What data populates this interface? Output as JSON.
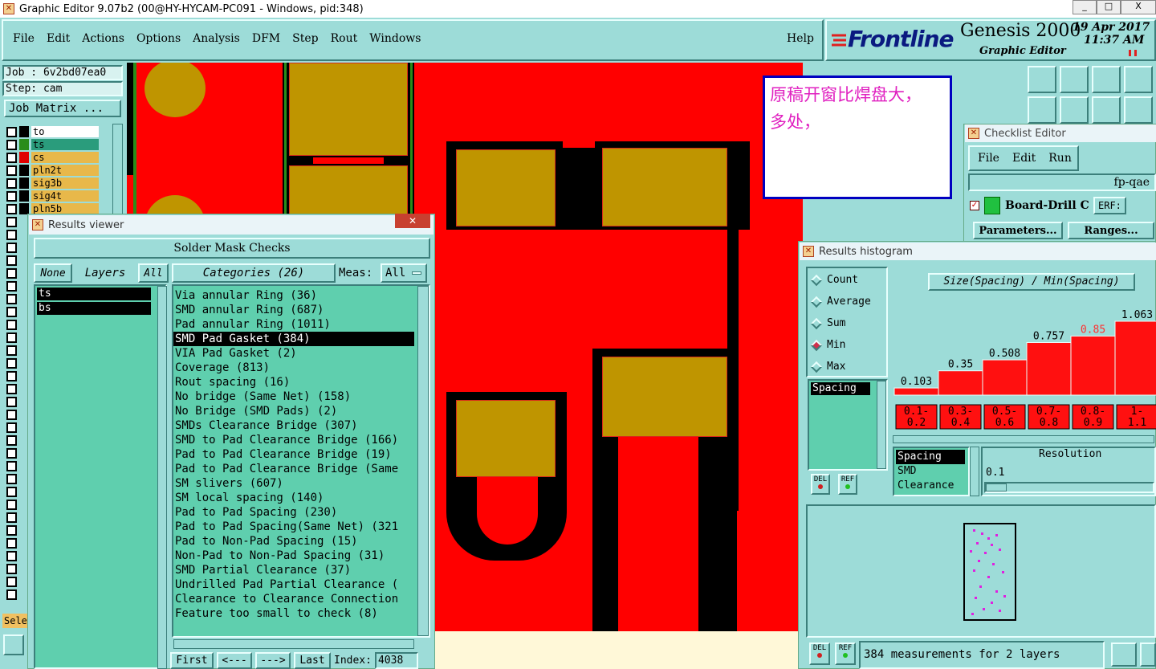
{
  "window": {
    "title": "Graphic Editor 9.07b2 (00@HY-HYCAM-PC091 - Windows, pid:348)",
    "min": "_",
    "max": "□",
    "close": "X"
  },
  "menu": [
    "File",
    "Edit",
    "Actions",
    "Options",
    "Analysis",
    "DFM",
    "Step",
    "Rout",
    "Windows"
  ],
  "help": "Help",
  "brand": {
    "logo": "Frontline",
    "product": "Genesis 2000",
    "subtitle": "Graphic Editor",
    "date": "19 Apr 2017",
    "time": "11:37 AM"
  },
  "job": {
    "job_label": "Job : 6v2bd07ea0",
    "step_label": "Step: cam",
    "matrix_button": "Job Matrix ..."
  },
  "layers": [
    {
      "name": "to",
      "color": "#ffffff"
    },
    {
      "name": "ts",
      "color": "#2a9c7c"
    },
    {
      "name": "cs",
      "color": "#e8b84a"
    },
    {
      "name": "pln2t",
      "color": "#e8b84a"
    },
    {
      "name": "sig3b",
      "color": "#e8b84a"
    },
    {
      "name": "sig4t",
      "color": "#e8b84a"
    },
    {
      "name": "pln5b",
      "color": "#e8b84a"
    }
  ],
  "sele_label": "Sele",
  "annotation": {
    "line1": "原稿开窗比焊盘大，",
    "line2": "多处，"
  },
  "results_viewer": {
    "title": "Results viewer",
    "header": "Solder Mask Checks",
    "none_btn": "None",
    "layers_label": "Layers",
    "all_btn": "All",
    "categories_label": "Categories (26)",
    "meas_label": "Meas:",
    "meas_value": "All",
    "layer_list": [
      "ts",
      "bs"
    ],
    "categories": [
      "Via annular Ring (36)",
      "SMD annular Ring (687)",
      "Pad annular Ring (1011)",
      "SMD Pad Gasket (384)",
      "VIA Pad Gasket (2)",
      "Coverage (813)",
      "Rout spacing (16)",
      "No bridge (Same Net) (158)",
      "No Bridge (SMD Pads) (2)",
      "SMDs Clearance Bridge (307)",
      "SMD to Pad Clearance Bridge (166)",
      "Pad to Pad Clearance Bridge (19)",
      "Pad to Pad Clearance Bridge (Same",
      "SM slivers (607)",
      "SM local spacing (140)",
      "Pad to Pad Spacing (230)",
      "Pad to Pad Spacing(Same Net) (321",
      "Pad to Non-Pad Spacing (15)",
      "Non-Pad to Non-Pad Spacing (31)",
      "SMD Partial Clearance (37)",
      "Undrilled Pad Partial Clearance (",
      "Clearance to Clearance Connection",
      "Feature too small to check (8)"
    ],
    "selected_index": 3,
    "nav": {
      "first": "First",
      "prev": "<---",
      "next": "--->",
      "last": "Last",
      "index_label": "Index:",
      "index_value": "4038"
    }
  },
  "checklist": {
    "title": "Checklist Editor",
    "menu": [
      "File",
      "Edit",
      "Run"
    ],
    "name": "fp-qae",
    "item": "Board-Drill Che",
    "erf": "ERF:",
    "parameters": "Parameters...",
    "ranges": "Ranges..."
  },
  "histogram": {
    "title": "Results histogram",
    "modes": [
      "Count",
      "Average",
      "Sum",
      "Min",
      "Max"
    ],
    "selected_mode": "Min",
    "chart_title": "Size(Spacing) / Min(Spacing)",
    "left_list": [
      "Spacing"
    ],
    "del": "DEL",
    "ref": "REF",
    "bin_list": [
      "Spacing",
      "SMD",
      "Clearance"
    ],
    "resolution_label": "Resolution",
    "resolution_value": "0.1",
    "status": "384 measurements for 2 layers",
    "highlight_color": "#ff3030",
    "chart_data": {
      "type": "bar",
      "categories": [
        "0.1-0.2",
        "0.3-0.4",
        "0.5-0.6",
        "0.7-0.8",
        "0.8-0.9",
        "1-1.1"
      ],
      "category_lines": [
        [
          "0.1-",
          "0.2"
        ],
        [
          "0.3-",
          "0.4"
        ],
        [
          "0.5-",
          "0.6"
        ],
        [
          "0.7-",
          "0.8"
        ],
        [
          "0.8-",
          "0.9"
        ],
        [
          "1-",
          "1.1"
        ]
      ],
      "values": [
        0.103,
        0.35,
        0.508,
        0.757,
        0.85,
        1.063
      ],
      "labels": [
        "0.103",
        "0.35",
        "0.508",
        "0.757",
        "0.85",
        "1.063"
      ],
      "highlight": 4,
      "ylim": [
        0,
        1.063
      ]
    }
  }
}
